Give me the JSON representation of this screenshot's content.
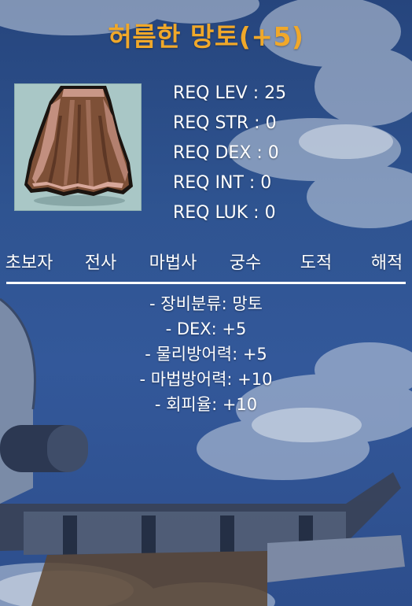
{
  "item": {
    "name": "허름한 망토(+5)",
    "icon": "brown-cape-icon"
  },
  "requirements": [
    "REQ LEV : 25",
    "REQ STR : 0",
    "REQ DEX : 0",
    "REQ INT : 0",
    "REQ LUK : 0"
  ],
  "classes": [
    "초보자",
    "전사",
    "마법사",
    "궁수",
    "도적",
    "해적"
  ],
  "stats": [
    "- 장비분류: 망토",
    "- DEX: +5",
    "- 물리방어력: +5",
    "- 마법방어력: +10",
    "- 회피율: +10"
  ],
  "colors": {
    "title": "#f0a82a",
    "text": "#ffffff",
    "background": "#2f5491"
  }
}
